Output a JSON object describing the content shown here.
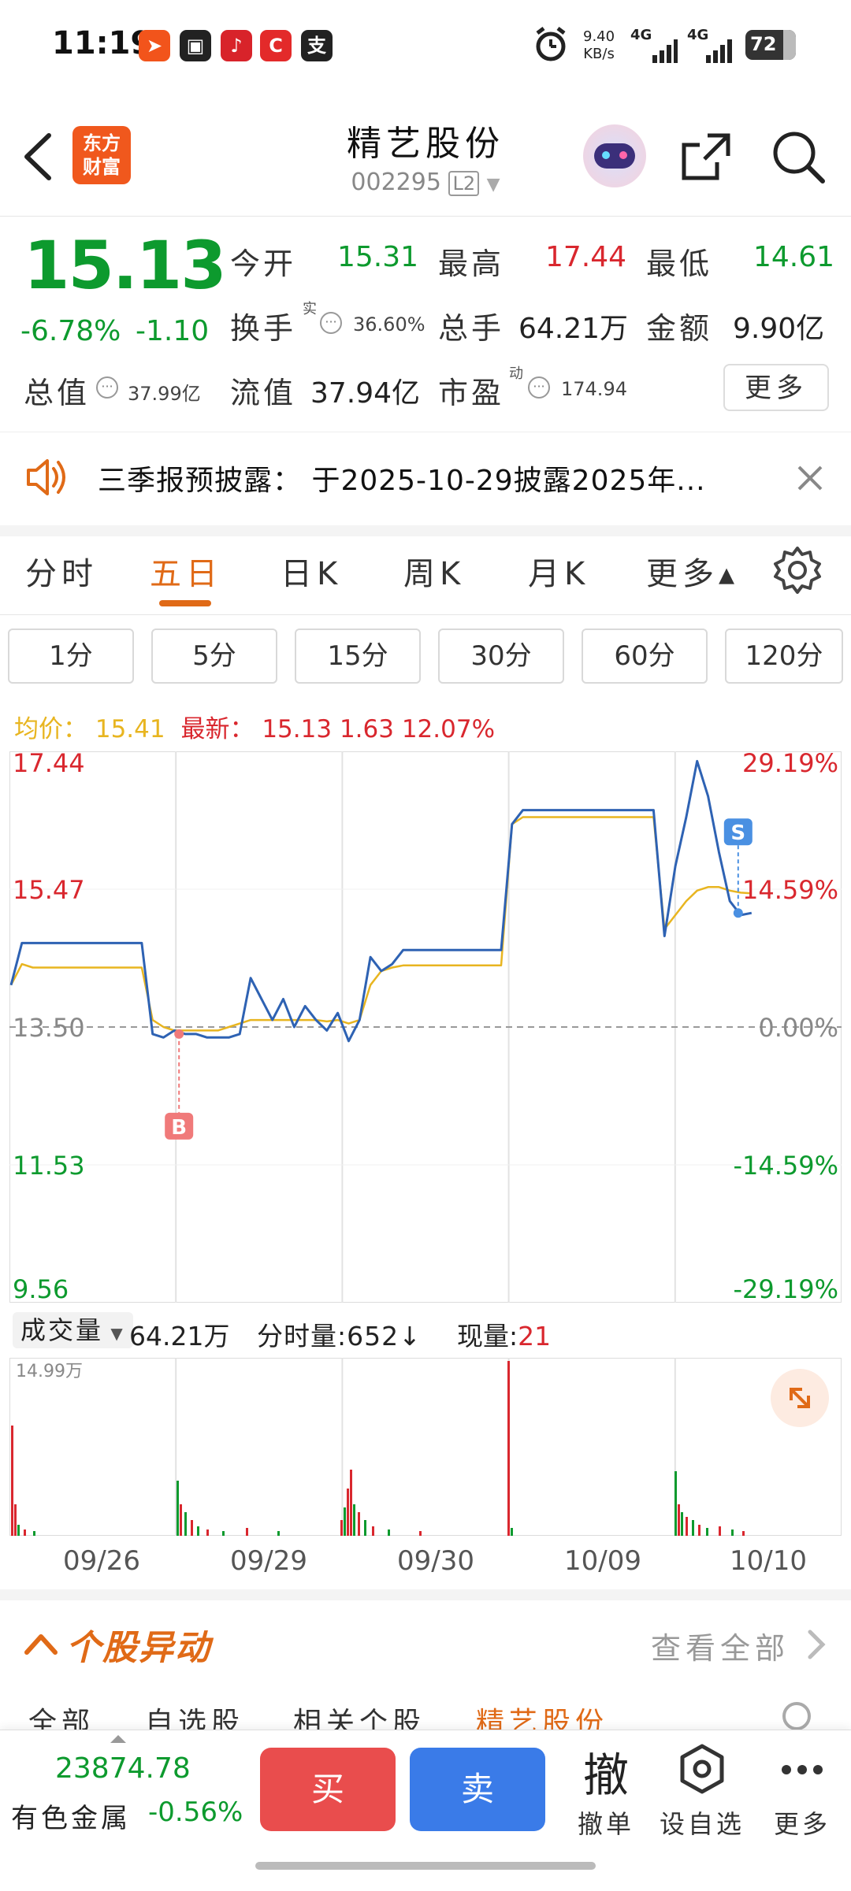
{
  "status_bar": {
    "time": "11:19",
    "net_speed_value": "9.40",
    "net_speed_unit": "KB/s",
    "signal1": "4G",
    "signal2": "4G",
    "battery": "72"
  },
  "header": {
    "title": "精艺股份",
    "code": "002295",
    "level_badge": "L2",
    "app_logo_line1": "东方",
    "app_logo_line2": "财富"
  },
  "quote": {
    "price": "15.13",
    "change_pct": "-6.78%",
    "change_abs": "-1.10",
    "open_label": "今开",
    "open_value": "15.31",
    "high_label": "最高",
    "high_value": "17.44",
    "low_label": "最低",
    "low_value": "14.61",
    "turnover_label": "换手",
    "turnover_sup": "实",
    "turnover_value": "36.60%",
    "volume_label": "总手",
    "volume_value": "64.21万",
    "amount_label": "金额",
    "amount_value": "9.90亿",
    "total_cap_label": "总值",
    "total_cap_value": "37.99亿",
    "float_cap_label": "流值",
    "float_cap_value": "37.94亿",
    "pe_label": "市盈",
    "pe_sup": "动",
    "pe_value": "174.94",
    "more_label": "更多"
  },
  "announcement": {
    "text": "三季报预披露： 于2025-10-29披露2025年..."
  },
  "tabs": [
    "分时",
    "五日",
    "日K",
    "周K",
    "月K",
    "更多▴"
  ],
  "active_tab": "五日",
  "periods": [
    "1分",
    "5分",
    "15分",
    "30分",
    "60分",
    "120分"
  ],
  "chart_info": {
    "avg_label": "均价：",
    "avg_value": "15.41",
    "latest_label": "最新：",
    "latest_price": "15.13",
    "latest_change": "1.63",
    "latest_pct": "12.07%"
  },
  "chart_data": {
    "type": "line",
    "title": "",
    "y_left_ticks": [
      "17.44",
      "15.47",
      "13.50",
      "11.53",
      "9.56"
    ],
    "y_right_ticks": [
      "29.19%",
      "14.59%",
      "0.00%",
      "-14.59%",
      "-29.19%"
    ],
    "ylim": [
      9.56,
      17.44
    ],
    "prev_close": 13.5,
    "x_labels": [
      "09/26",
      "09/29",
      "09/30",
      "10/09",
      "10/10"
    ],
    "series": [
      {
        "values": [
          14.1,
          14.7,
          14.7,
          14.7,
          14.7,
          14.7,
          14.7,
          14.7,
          14.7,
          14.7,
          14.7,
          14.7,
          14.7,
          13.4,
          13.35,
          13.45,
          13.4,
          13.4,
          13.35,
          13.35,
          13.35,
          13.4,
          14.2,
          13.9,
          13.6,
          13.9,
          13.5,
          13.8,
          13.6,
          13.45,
          13.7,
          13.3,
          13.6,
          14.5,
          14.3,
          14.4,
          14.6,
          14.6,
          14.6,
          14.6,
          14.6,
          14.6,
          14.6,
          14.6,
          14.6,
          14.6,
          16.4,
          16.6,
          16.6,
          16.6,
          16.6,
          16.6,
          16.6,
          16.6,
          16.6,
          16.6,
          16.6,
          16.6,
          16.6,
          16.6,
          14.8,
          15.8,
          16.5,
          17.3,
          16.8,
          16.0,
          15.3,
          15.1,
          15.13
        ]
      },
      {
        "values": [
          14.1,
          14.4,
          14.35,
          14.35,
          14.35,
          14.35,
          14.35,
          14.35,
          14.35,
          14.35,
          14.35,
          14.35,
          14.35,
          13.6,
          13.5,
          13.45,
          13.45,
          13.45,
          13.45,
          13.45,
          13.5,
          13.55,
          13.6,
          13.6,
          13.6,
          13.6,
          13.6,
          13.6,
          13.6,
          13.58,
          13.6,
          13.55,
          13.6,
          14.1,
          14.3,
          14.35,
          14.38,
          14.38,
          14.38,
          14.38,
          14.38,
          14.38,
          14.38,
          14.38,
          14.38,
          14.38,
          16.4,
          16.5,
          16.5,
          16.5,
          16.5,
          16.5,
          16.5,
          16.5,
          16.5,
          16.5,
          16.5,
          16.5,
          16.5,
          16.5,
          14.9,
          15.1,
          15.3,
          15.45,
          15.5,
          15.5,
          15.45,
          15.42,
          15.41
        ]
      }
    ],
    "markers": [
      {
        "label": "B",
        "day": "09/29",
        "price": 13.4
      },
      {
        "label": "S",
        "day": "10/10",
        "price": 15.13
      }
    ]
  },
  "volume": {
    "label": "成交量",
    "total": "64.21万",
    "minute_label": "分时量:",
    "minute_value": "652",
    "minute_arrow": "↓",
    "current_label": "现量:",
    "current_value": "21",
    "max_label": "14.99万"
  },
  "movement": {
    "title": "个股异动",
    "view_all": "查看全部"
  },
  "subtabs": [
    "全部",
    "自选股",
    "相关个股",
    "精艺股份"
  ],
  "bottom": {
    "index_value": "23874.78",
    "index_name": "有色金属",
    "index_change": "-0.56%",
    "buy": "买",
    "sell": "卖",
    "cancel_icon": "撤",
    "cancel": "撤单",
    "watchlist": "设自选",
    "more": "更多"
  },
  "colors": {
    "up": "#d9272e",
    "down": "#0d9a2e",
    "accent": "#e06a17",
    "price_line": "#2e62b3",
    "avg_line": "#e8b520"
  }
}
